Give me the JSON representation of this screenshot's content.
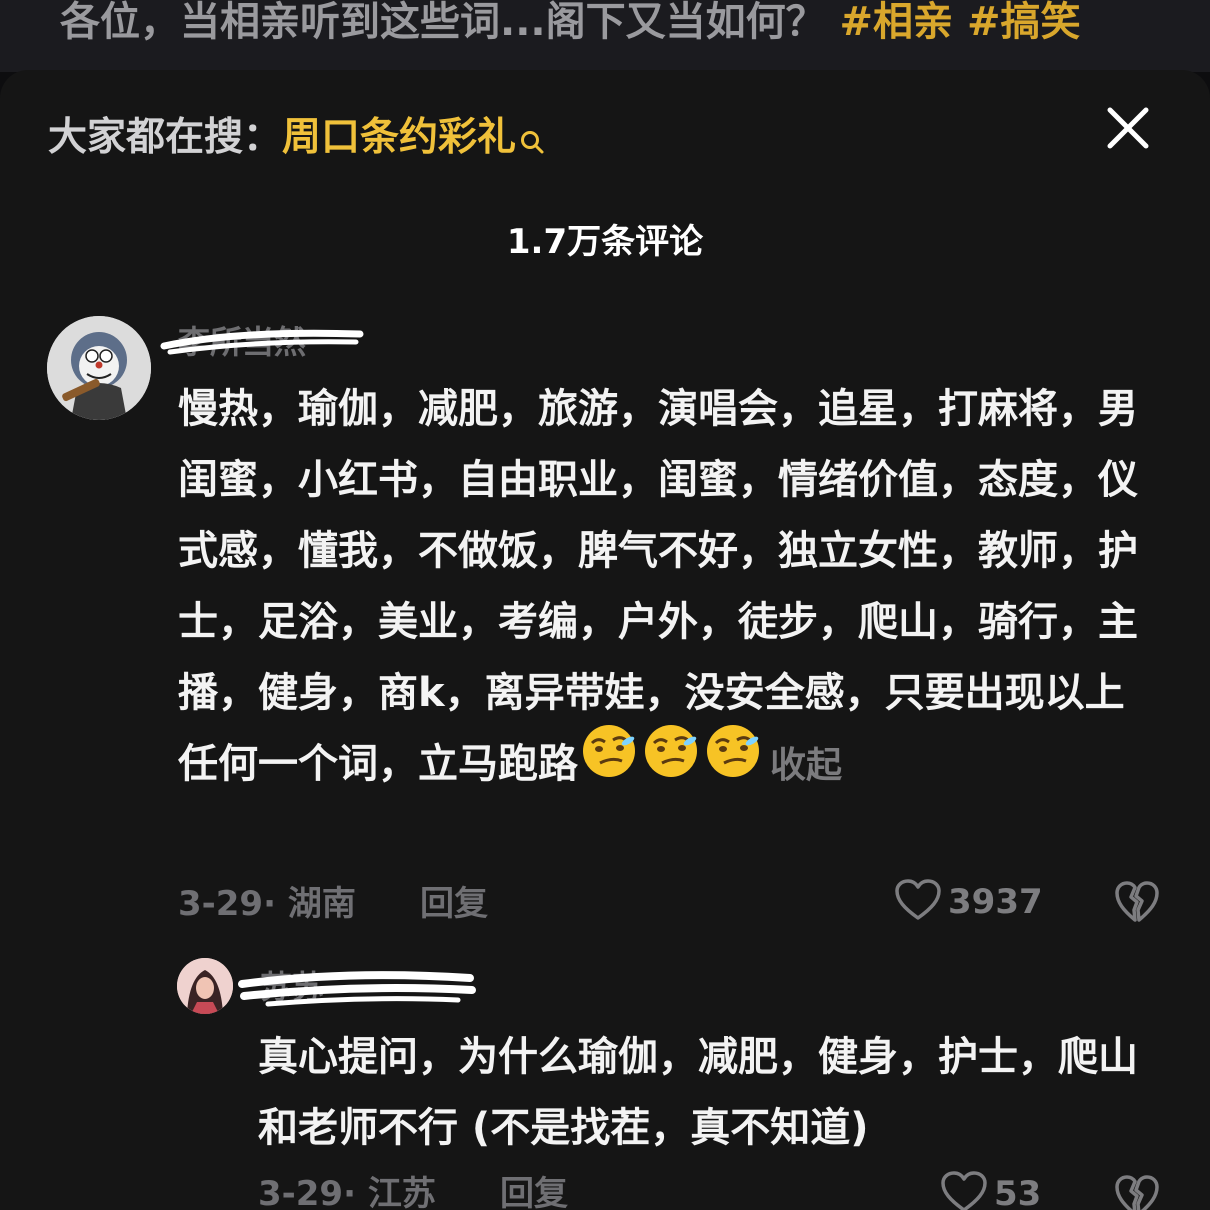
{
  "video": {
    "caption": "各位，当相亲听到这些词...阁下又当如何？",
    "tags": "#相亲 #搞笑"
  },
  "search": {
    "label": "大家都在搜：",
    "term": "周口条约彩礼"
  },
  "comment_count": "1.7万条评论",
  "comments": [
    {
      "username": "李所当然",
      "text": "慢热，瑜伽，减肥，旅游，演唱会，追星，打麻将，男闺蜜，小红书，自由职业，闺蜜，情绪价值，态度，仪式感，懂我，不做饭，脾气不好，独立女性，教师，护士，足浴，美业，考编，户外，徒步，爬山，骑行，主播，健身，商k，离异带娃，没安全感，只要出现以上任何一个词，立马跑路",
      "collapse_label": "收起",
      "date_location": "3-29· 湖南",
      "reply_label": "回复",
      "likes": "3937"
    },
    {
      "username": "苏苏",
      "text": "真心提问，为什么瑜伽，减肥，健身，护士，爬山和老师不行 (不是找茬，真不知道)",
      "date_location": "3-29· 江苏",
      "reply_label": "回复",
      "likes": "53"
    }
  ],
  "colors": {
    "background": "#151515",
    "highlight": "#f0c13a",
    "muted": "#6f6f73"
  },
  "icons": [
    "search-icon",
    "close-icon",
    "heart-icon",
    "broken-heart-icon",
    "thinking-emoji"
  ]
}
